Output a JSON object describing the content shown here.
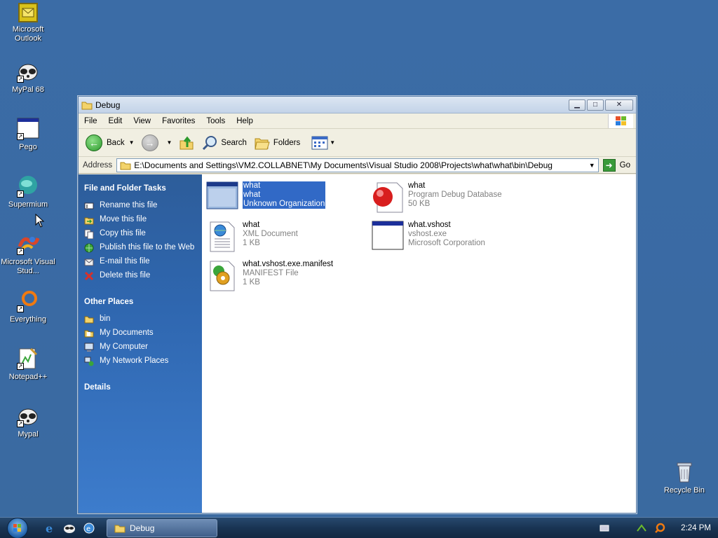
{
  "desktop": {
    "icons": [
      {
        "label": "Microsoft Outlook",
        "icon": "outlook-icon"
      },
      {
        "label": "MyPal 68",
        "icon": "raccoon-icon"
      },
      {
        "label": "Pego",
        "icon": "window-app-icon"
      },
      {
        "label": "Supermium",
        "icon": "supermium-icon"
      },
      {
        "label": "Microsoft Visual Stud...",
        "icon": "visual-studio-icon"
      },
      {
        "label": "Everything",
        "icon": "search-ring-icon"
      },
      {
        "label": "Notepad++",
        "icon": "notepadpp-icon"
      },
      {
        "label": "Mypal",
        "icon": "raccoon-icon"
      },
      {
        "label": "Recycle Bin",
        "icon": "recycle-bin-icon"
      }
    ]
  },
  "window": {
    "title": "Debug",
    "menu": [
      "File",
      "Edit",
      "View",
      "Favorites",
      "Tools",
      "Help"
    ],
    "toolbar": {
      "back": "Back",
      "search": "Search",
      "folders": "Folders"
    },
    "address": {
      "label": "Address",
      "path": "E:\\Documents and Settings\\VM2.COLLABNET\\My Documents\\Visual Studio 2008\\Projects\\what\\what\\bin\\Debug",
      "go": "Go"
    },
    "tasks": {
      "file_folder_title": "File and Folder Tasks",
      "items": [
        {
          "label": "Rename this file",
          "icon": "rename-icon"
        },
        {
          "label": "Move this file",
          "icon": "move-icon"
        },
        {
          "label": "Copy this file",
          "icon": "copy-icon"
        },
        {
          "label": "Publish this file to the Web",
          "icon": "publish-icon"
        },
        {
          "label": "E-mail this file",
          "icon": "email-icon"
        },
        {
          "label": "Delete this file",
          "icon": "delete-icon"
        }
      ],
      "other_places_title": "Other Places",
      "places": [
        {
          "label": "bin",
          "icon": "folder-icon"
        },
        {
          "label": "My Documents",
          "icon": "my-documents-icon"
        },
        {
          "label": "My Computer",
          "icon": "my-computer-icon"
        },
        {
          "label": "My Network Places",
          "icon": "network-places-icon"
        }
      ],
      "details_title": "Details"
    },
    "files": [
      {
        "name": "what",
        "line2": "what",
        "line3": "Unknown Organization",
        "selected": true,
        "icon": "exe-window-icon"
      },
      {
        "name": "what",
        "line2": "Program Debug Database",
        "line3": "50 KB",
        "selected": false,
        "icon": "pdb-icon"
      },
      {
        "name": "what",
        "line2": "XML Document",
        "line3": "1 KB",
        "selected": false,
        "icon": "xml-document-icon"
      },
      {
        "name": "what.vshost",
        "line2": "vshost.exe",
        "line3": "Microsoft Corporation",
        "selected": false,
        "icon": "exe-window-icon"
      },
      {
        "name": "what.vshost.exe.manifest",
        "line2": "MANIFEST File",
        "line3": "1 KB",
        "selected": false,
        "icon": "manifest-icon"
      }
    ]
  },
  "taskbar": {
    "task_label": "Debug",
    "clock": "2:24 PM"
  }
}
